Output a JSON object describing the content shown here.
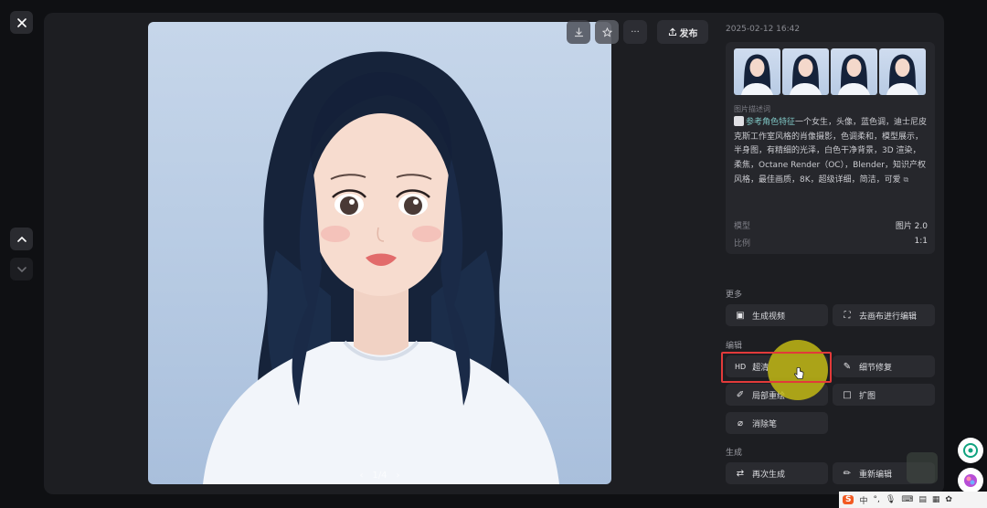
{
  "toolbar": {
    "publish_label": "发布",
    "more_label": "···"
  },
  "viewer": {
    "page_indicator": "1/4"
  },
  "sidebar": {
    "timestamp": "2025-02-12 16:42",
    "desc_label": "图片描述词",
    "ref_tag": "参考角色特征",
    "description": "一个女生，头像，蓝色调，迪士尼皮克斯工作室风格的肖像摄影，色调柔和，模型展示，半身图，有精细的光泽，白色干净背景，3D 渲染，柔焦，Octane Render（OC），Blender，知识产权风格，最佳画质，8K，超级详细，简洁，可爱",
    "meta": [
      {
        "key": "模型",
        "value": "图片 2.0"
      },
      {
        "key": "比例",
        "value": "1:1"
      }
    ]
  },
  "sections": {
    "more_label": "更多",
    "edit_label": "编辑",
    "generate_label": "生成"
  },
  "actions": {
    "generate_video": "生成视频",
    "canvas_edit": "去画布进行编辑",
    "hd_prefix": "HD",
    "hd_upscale": "超清",
    "detail_fix": "细节修复",
    "inpaint": "局部重绘",
    "outpaint": "扩图",
    "eraser": "消除笔",
    "regenerate": "再次生成",
    "reedit": "重新编辑"
  },
  "taskbar": {
    "s_label": "S",
    "lang": "中",
    "punct": "°,"
  },
  "colors": {
    "highlight": "#e23a3a",
    "cursor": "#c8be14",
    "accent_tag": "#7fc6c4"
  }
}
